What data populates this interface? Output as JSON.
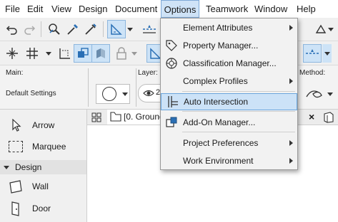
{
  "menubar": {
    "items": [
      "File",
      "Edit",
      "View",
      "Design",
      "Document",
      "Options",
      "Teamwork",
      "Window",
      "Help"
    ],
    "active": "Options"
  },
  "infobox": {
    "main_label": "Main:",
    "layer_label": "Layer:",
    "method_label": "Method:",
    "favorites_value": "Default Settings",
    "layer_value": "2"
  },
  "toolbox": {
    "items": [
      "Arrow",
      "Marquee",
      "Wall",
      "Door"
    ],
    "group": "Design"
  },
  "view_tab": {
    "label": "[0. Ground"
  },
  "options_menu": {
    "items": [
      {
        "label": "Element Attributes",
        "submenu": true
      },
      {
        "label": "Property Manager..."
      },
      {
        "label": "Classification Manager..."
      },
      {
        "label": "Complex Profiles",
        "submenu": true
      },
      {
        "label": "Auto Intersection",
        "highlighted": true
      },
      {
        "label": "Add-On Manager..."
      },
      {
        "label": "Project Preferences",
        "submenu": true
      },
      {
        "label": "Work Environment",
        "submenu": true
      }
    ]
  },
  "colors": {
    "menu_highlight": "#cce2f7",
    "selection_border": "#6aa5dc",
    "tool_blue": "#2a6fb5"
  }
}
